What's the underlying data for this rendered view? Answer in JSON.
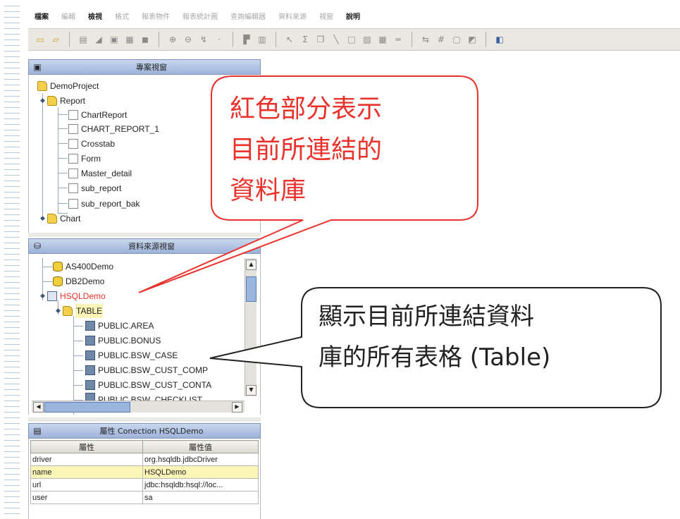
{
  "menubar": {
    "items": [
      "檔案",
      "編輯",
      "檢視",
      "格式",
      "報表物件",
      "報表統計圖",
      "查詢編輯器",
      "資料來源",
      "視窗",
      "說明"
    ],
    "active": [
      0,
      2,
      9
    ]
  },
  "toolbar": {
    "icons": [
      "new-icon",
      "open-icon",
      "sep",
      "field-icon",
      "chart-icon",
      "image-icon",
      "grid-icon",
      "db-icon",
      "sep",
      "zoom-in-icon",
      "zoom-out-icon",
      "zoom-fit-icon",
      "sep",
      "align-icon",
      "align-right-icon",
      "sep",
      "pointer-icon",
      "sum-icon",
      "copy-icon",
      "line-icon",
      "rect-icon",
      "text-icon",
      "table-icon",
      "hline-icon",
      "sep",
      "toggle-icon",
      "number-icon",
      "frame-icon",
      "export-icon",
      "sep",
      "save-icon"
    ]
  },
  "project_window": {
    "title": "專案視窗",
    "nodes": [
      "DemoProject",
      "Report",
      "ChartReport",
      "CHART_REPORT_1",
      "Crosstab",
      "Form",
      "Master_detail",
      "sub_report",
      "sub_report_bak",
      "Chart"
    ]
  },
  "datasource_window": {
    "title": "資料來源視窗",
    "nodes": [
      "AS400Demo",
      "DB2Demo",
      "HSQLDemo",
      "TABLE",
      "PUBLIC.AREA",
      "PUBLIC.BONUS",
      "PUBLIC.BSW_CASE",
      "PUBLIC.BSW_CUST_COMP",
      "PUBLIC.BSW_CUST_CONTA",
      "PUBLIC.BSW_CHECKLIST"
    ]
  },
  "properties": {
    "title": "屬性 Conection HSQLDemo",
    "columns": [
      "屬性",
      "屬性值"
    ],
    "rows": [
      {
        "key": "driver",
        "value": "org.hsqldb.jdbcDriver"
      },
      {
        "key": "name",
        "value": "HSQLDemo"
      },
      {
        "key": "url",
        "value": "jdbc:hsqldb:hsql://loc..."
      },
      {
        "key": "user",
        "value": "sa"
      }
    ]
  },
  "callouts": {
    "red": [
      "紅色部分表示",
      "目前所連結的",
      "資料庫"
    ],
    "black": [
      "顯示目前所連結資料",
      "庫的所有表格 (Table)"
    ]
  },
  "colors": {
    "active_db": "#e8322b",
    "highlight_row": "#fbf5b8",
    "panel_head": "#9db3da"
  }
}
